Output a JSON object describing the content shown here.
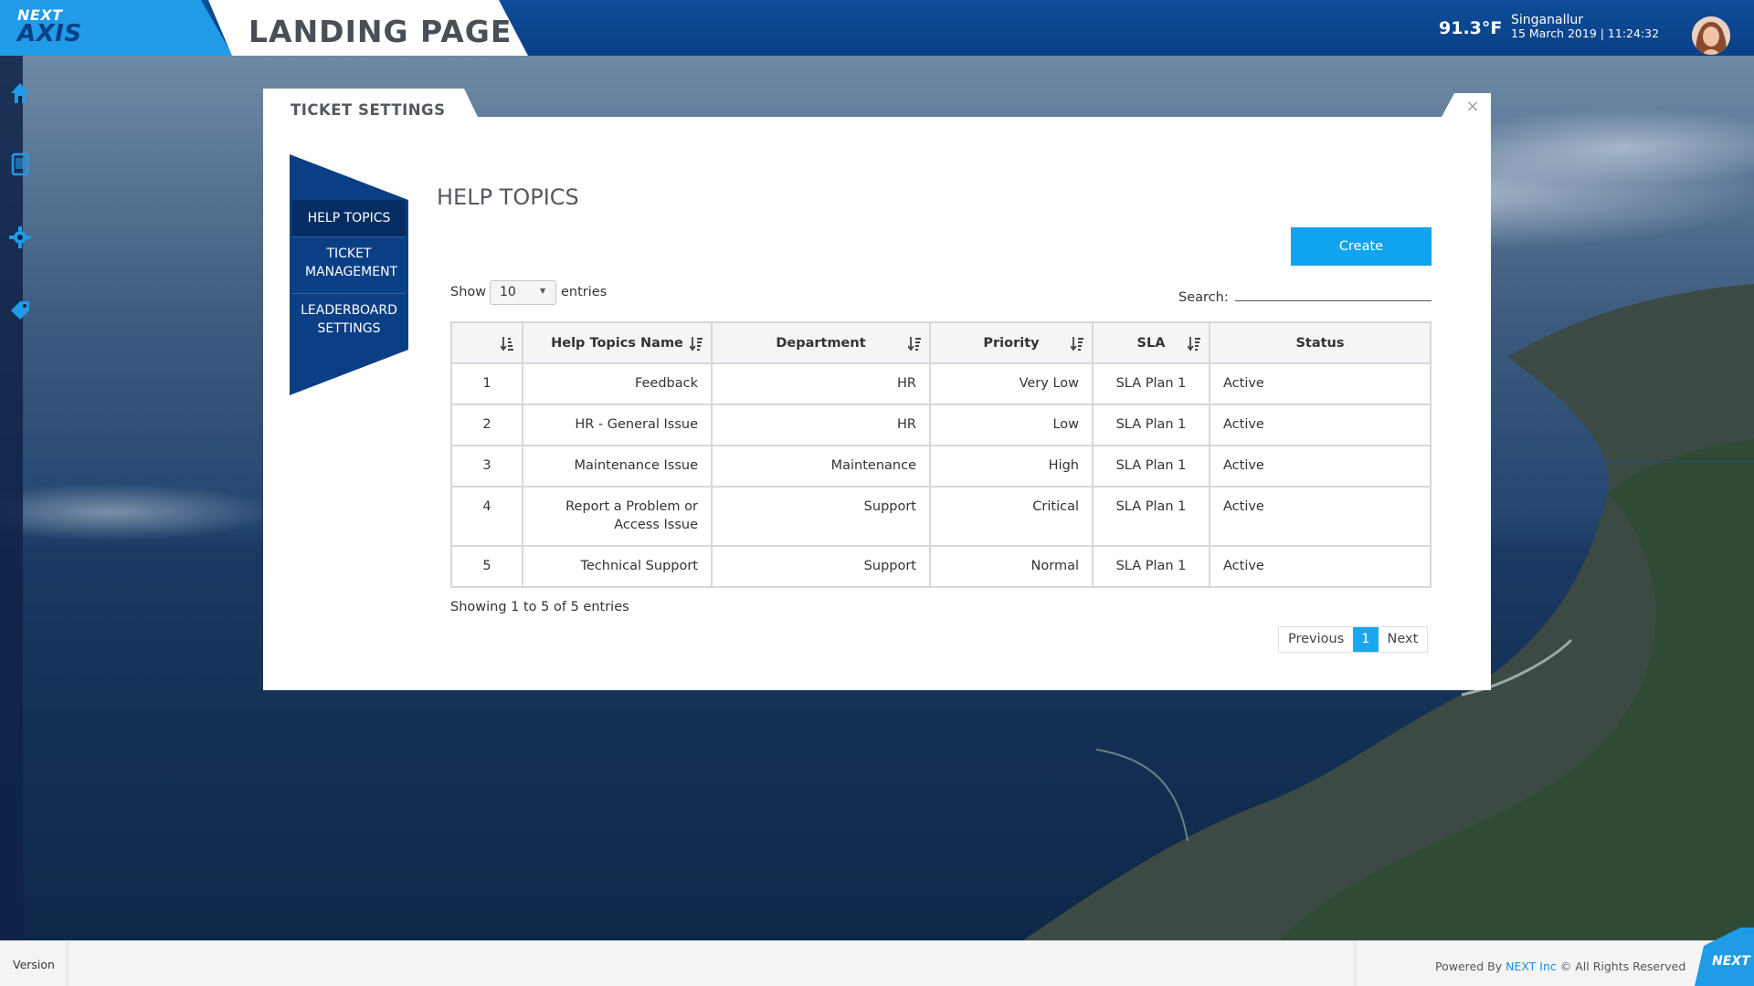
{
  "header": {
    "logo_top": "NEXT",
    "logo_bottom": "AXIS",
    "title": "LANDING PAGE",
    "temperature": "91.3°F",
    "location": "Singanallur",
    "datetime": "15 March 2019 | 11:24:32",
    "accent_color": "#1f9be8",
    "bar_color": "#0a3f85"
  },
  "left_rail": {
    "icons": [
      "home-icon",
      "tablet-icon",
      "gear-icon",
      "tag-icon"
    ]
  },
  "modal": {
    "title": "TICKET SETTINGS",
    "close_glyph": "×",
    "side_menu": [
      {
        "label": "HELP TOPICS",
        "active": true
      },
      {
        "label": "TICKET MANAGEMENT",
        "active": false
      },
      {
        "label": "LEADERBOARD SETTINGS",
        "active": false
      }
    ],
    "section_title": "HELP TOPICS",
    "create_label": "Create",
    "show_label": "Show",
    "page_size": "10",
    "entries_label": "entries",
    "search_label": "Search:",
    "search_value": "",
    "columns": [
      "",
      "Help Topics Name",
      "Department",
      "Priority",
      "SLA",
      "Status"
    ],
    "rows": [
      {
        "num": "1",
        "name": "Feedback",
        "dept": "HR",
        "priority": "Very Low",
        "sla": "SLA Plan 1",
        "status": "Active"
      },
      {
        "num": "2",
        "name": "HR - General Issue",
        "dept": "HR",
        "priority": "Low",
        "sla": "SLA Plan 1",
        "status": "Active"
      },
      {
        "num": "3",
        "name": "Maintenance Issue",
        "dept": "Maintenance",
        "priority": "High",
        "sla": "SLA Plan 1",
        "status": "Active"
      },
      {
        "num": "4",
        "name": "Report a Problem or Access Issue",
        "dept": "Support",
        "priority": "Critical",
        "sla": "SLA Plan 1",
        "status": "Active"
      },
      {
        "num": "5",
        "name": "Technical Support",
        "dept": "Support",
        "priority": "Normal",
        "sla": "SLA Plan 1",
        "status": "Active"
      }
    ],
    "info": "Showing 1 to 5 of 5 entries",
    "pagination": {
      "previous": "Previous",
      "current": "1",
      "next": "Next"
    },
    "button_color": "#0fa3f0"
  },
  "footer": {
    "version": "Version",
    "powered_prefix": "Powered By",
    "brand": "NEXT Inc",
    "powered_suffix": "© All Rights Reserved",
    "corner_logo": "NEXT"
  }
}
